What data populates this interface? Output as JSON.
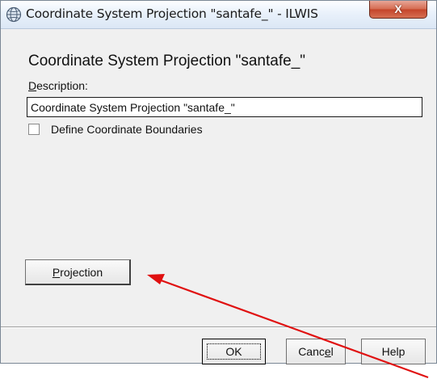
{
  "window": {
    "title": "Coordinate System Projection \"santafe_\" - ILWIS",
    "close_label": "X"
  },
  "dialog": {
    "heading": "Coordinate System Projection \"santafe_\"",
    "description_label_accel": "D",
    "description_label_rest": "escription:",
    "description_value": "Coordinate System Projection \"santafe_\"",
    "define_boundaries_label": "Define Coordinate Boundaries",
    "define_boundaries_checked": false,
    "projection_button_accel": "P",
    "projection_button_rest": "rojection"
  },
  "footer": {
    "ok_label": "OK",
    "cancel_label_pre": "Canc",
    "cancel_label_accel": "e",
    "cancel_label_post": "l",
    "help_label": "Help"
  },
  "annotation": {
    "arrow_color": "#e01010"
  },
  "icons": {
    "title_icon": "globe-icon"
  }
}
